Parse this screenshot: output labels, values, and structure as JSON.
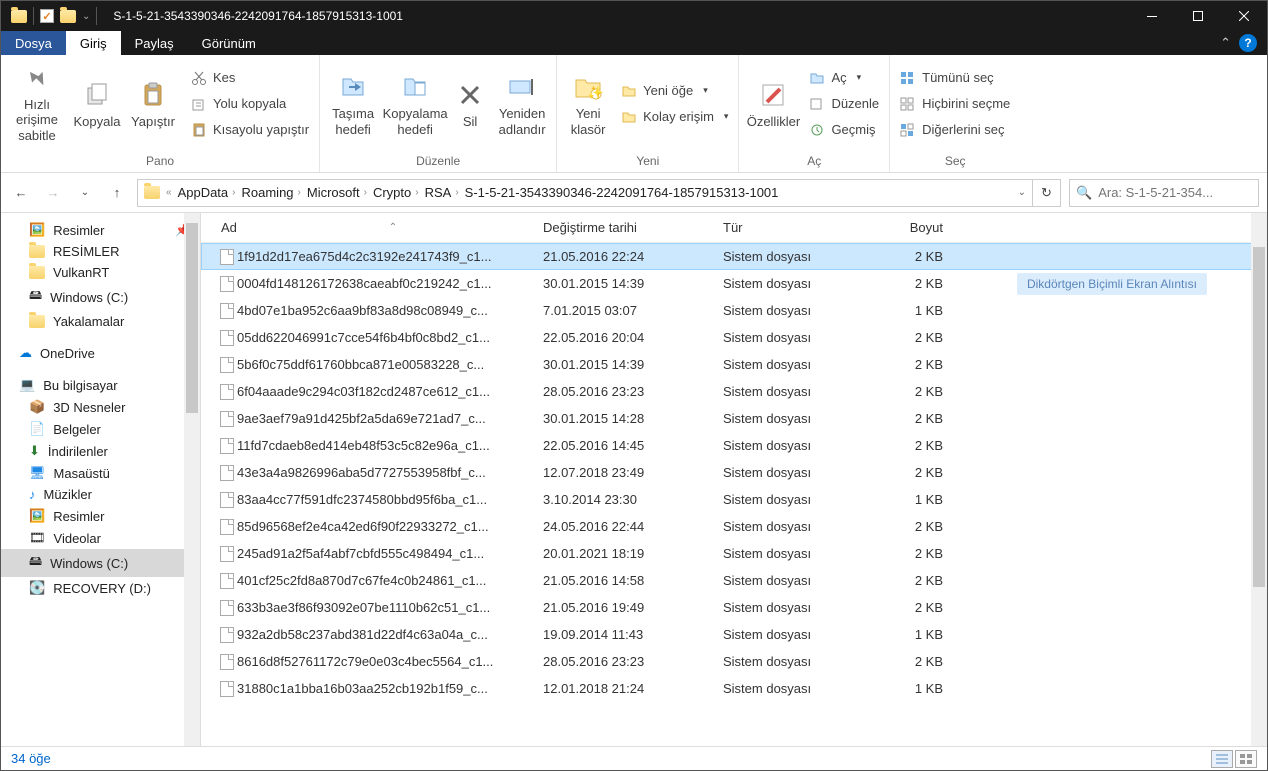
{
  "window": {
    "title": "S-1-5-21-3543390346-2242091764-1857915313-1001"
  },
  "tabs": {
    "file": "Dosya",
    "home": "Giriş",
    "share": "Paylaş",
    "view": "Görünüm"
  },
  "ribbon": {
    "clipboard": {
      "pin": "Hızlı erişime\nsabitle",
      "copy": "Kopyala",
      "paste": "Yapıştır",
      "cut": "Kes",
      "copy_path": "Yolu kopyala",
      "paste_shortcut": "Kısayolu yapıştır",
      "label": "Pano"
    },
    "organize": {
      "move": "Taşıma\nhedefi",
      "copy_to": "Kopyalama\nhedefi",
      "delete": "Sil",
      "rename": "Yeniden\nadlandır",
      "label": "Düzenle"
    },
    "new": {
      "new_folder": "Yeni\nklasör",
      "new_item": "Yeni öğe",
      "easy_access": "Kolay erişim",
      "label": "Yeni"
    },
    "open": {
      "properties": "Özellikler",
      "open": "Aç",
      "edit": "Düzenle",
      "history": "Geçmiş",
      "label": "Aç"
    },
    "select": {
      "all": "Tümünü seç",
      "none": "Hiçbirini seçme",
      "invert": "Diğerlerini seç",
      "label": "Seç"
    }
  },
  "breadcrumb": [
    "AppData",
    "Roaming",
    "Microsoft",
    "Crypto",
    "RSA",
    "S-1-5-21-3543390346-2242091764-1857915313-1001"
  ],
  "search": {
    "placeholder": "Ara: S-1-5-21-354..."
  },
  "nav": {
    "quick": [
      "Resimler",
      "RESİMLER",
      "VulkanRT",
      "Windows (C:)",
      "Yakalamalar"
    ],
    "onedrive": "OneDrive",
    "thispc": "Bu bilgisayar",
    "thispc_items": [
      "3D Nesneler",
      "Belgeler",
      "İndirilenler",
      "Masaüstü",
      "Müzikler",
      "Resimler",
      "Videolar",
      "Windows (C:)",
      "RECOVERY (D:)"
    ]
  },
  "columns": {
    "name": "Ad",
    "date": "Değiştirme tarihi",
    "type": "Tür",
    "size": "Boyut"
  },
  "files": [
    {
      "name": "1f91d2d17ea675d4c2c3192e241743f9_c1...",
      "date": "21.05.2016 22:24",
      "type": "Sistem dosyası",
      "size": "2 KB"
    },
    {
      "name": "0004fd148126172638caeabf0c219242_c1...",
      "date": "30.01.2015 14:39",
      "type": "Sistem dosyası",
      "size": "2 KB"
    },
    {
      "name": "4bd07e1ba952c6aa9bf83a8d98c08949_c...",
      "date": "7.01.2015 03:07",
      "type": "Sistem dosyası",
      "size": "1 KB"
    },
    {
      "name": "05dd622046991c7cce54f6b4bf0c8bd2_c1...",
      "date": "22.05.2016 20:04",
      "type": "Sistem dosyası",
      "size": "2 KB"
    },
    {
      "name": "5b6f0c75ddf61760bbca871e00583228_c...",
      "date": "30.01.2015 14:39",
      "type": "Sistem dosyası",
      "size": "2 KB"
    },
    {
      "name": "6f04aaade9c294c03f182cd2487ce612_c1...",
      "date": "28.05.2016 23:23",
      "type": "Sistem dosyası",
      "size": "2 KB"
    },
    {
      "name": "9ae3aef79a91d425bf2a5da69e721ad7_c...",
      "date": "30.01.2015 14:28",
      "type": "Sistem dosyası",
      "size": "2 KB"
    },
    {
      "name": "11fd7cdaeb8ed414eb48f53c5c82e96a_c1...",
      "date": "22.05.2016 14:45",
      "type": "Sistem dosyası",
      "size": "2 KB"
    },
    {
      "name": "43e3a4a9826996aba5d7727553958fbf_c...",
      "date": "12.07.2018 23:49",
      "type": "Sistem dosyası",
      "size": "2 KB"
    },
    {
      "name": "83aa4cc77f591dfc2374580bbd95f6ba_c1...",
      "date": "3.10.2014 23:30",
      "type": "Sistem dosyası",
      "size": "1 KB"
    },
    {
      "name": "85d96568ef2e4ca42ed6f90f22933272_c1...",
      "date": "24.05.2016 22:44",
      "type": "Sistem dosyası",
      "size": "2 KB"
    },
    {
      "name": "245ad91a2f5af4abf7cbfd555c498494_c1...",
      "date": "20.01.2021 18:19",
      "type": "Sistem dosyası",
      "size": "2 KB"
    },
    {
      "name": "401cf25c2fd8a870d7c67fe4c0b24861_c1...",
      "date": "21.05.2016 14:58",
      "type": "Sistem dosyası",
      "size": "2 KB"
    },
    {
      "name": "633b3ae3f86f93092e07be1110b62c51_c1...",
      "date": "21.05.2016 19:49",
      "type": "Sistem dosyası",
      "size": "2 KB"
    },
    {
      "name": "932a2db58c237abd381d22df4c63a04a_c...",
      "date": "19.09.2014 11:43",
      "type": "Sistem dosyası",
      "size": "1 KB"
    },
    {
      "name": "8616d8f52761172c79e0e03c4bec5564_c1...",
      "date": "28.05.2016 23:23",
      "type": "Sistem dosyası",
      "size": "2 KB"
    },
    {
      "name": "31880c1a1bba16b03aa252cb192b1f59_c...",
      "date": "12.01.2018 21:24",
      "type": "Sistem dosyası",
      "size": "1 KB"
    }
  ],
  "overlay": "Dikdörtgen Biçimli Ekran Alıntısı",
  "status": {
    "count": "34 öğe"
  }
}
